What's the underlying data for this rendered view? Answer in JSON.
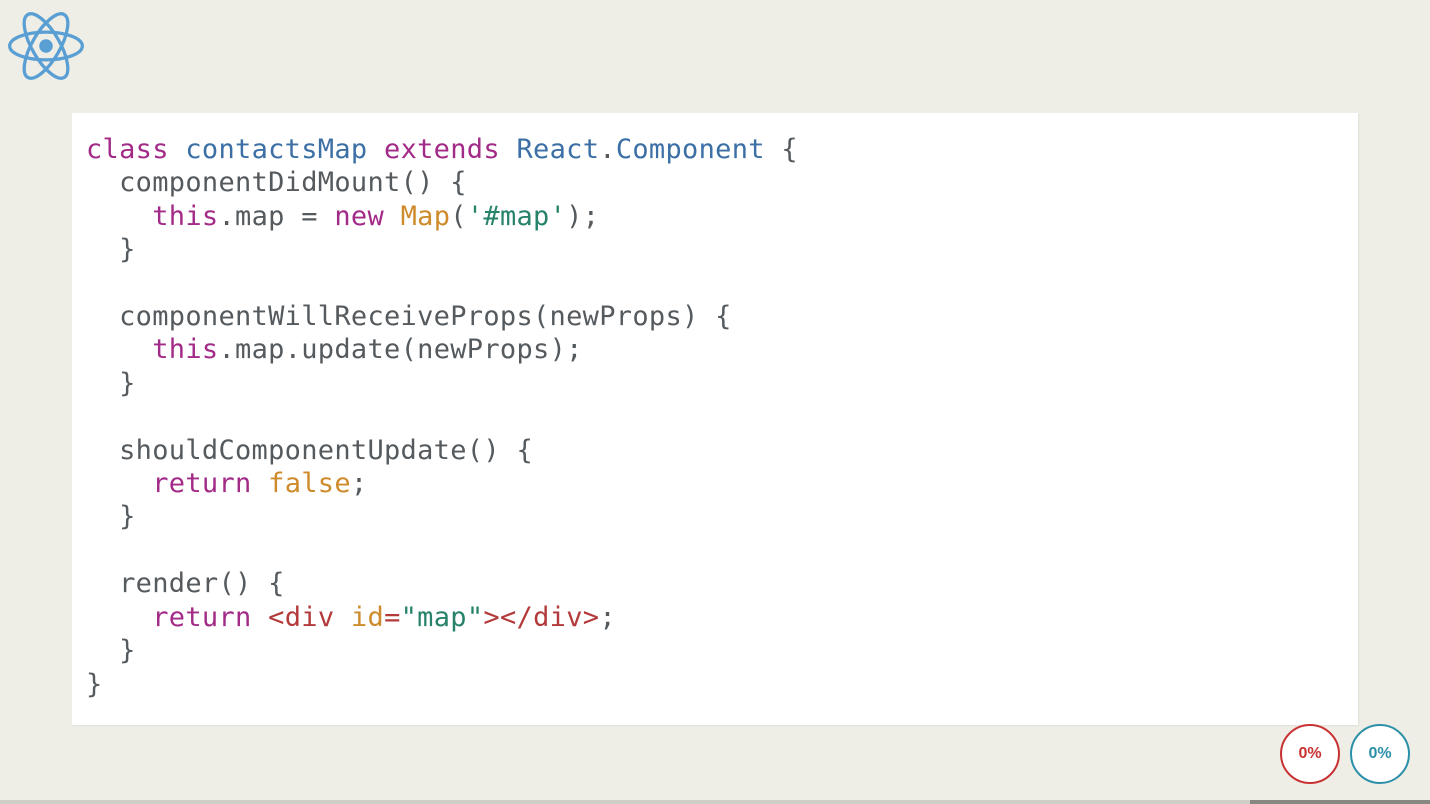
{
  "logo": {
    "name": "react-logo"
  },
  "code": {
    "tokens": [
      [
        {
          "t": "class",
          "c": "tok-keyword"
        },
        {
          "t": " "
        },
        {
          "t": "contactsMap",
          "c": "tok-classname"
        },
        {
          "t": " "
        },
        {
          "t": "extends",
          "c": "tok-keyword"
        },
        {
          "t": " "
        },
        {
          "t": "React",
          "c": "tok-builtin"
        },
        {
          "t": "."
        },
        {
          "t": "Component",
          "c": "tok-builtin"
        },
        {
          "t": " {"
        }
      ],
      [
        {
          "t": "  componentDidMount() {"
        }
      ],
      [
        {
          "t": "    "
        },
        {
          "t": "this",
          "c": "tok-this"
        },
        {
          "t": ".map = "
        },
        {
          "t": "new",
          "c": "tok-new"
        },
        {
          "t": " "
        },
        {
          "t": "Map",
          "c": "tok-func"
        },
        {
          "t": "("
        },
        {
          "t": "'#map'",
          "c": "tok-string"
        },
        {
          "t": ");"
        }
      ],
      [
        {
          "t": "  }"
        }
      ],
      [
        {
          "t": ""
        }
      ],
      [
        {
          "t": "  componentWillReceiveProps(newProps) {"
        }
      ],
      [
        {
          "t": "    "
        },
        {
          "t": "this",
          "c": "tok-this"
        },
        {
          "t": ".map.update(newProps);"
        }
      ],
      [
        {
          "t": "  }"
        }
      ],
      [
        {
          "t": ""
        }
      ],
      [
        {
          "t": "  shouldComponentUpdate() {"
        }
      ],
      [
        {
          "t": "    "
        },
        {
          "t": "return",
          "c": "tok-return"
        },
        {
          "t": " "
        },
        {
          "t": "false",
          "c": "tok-bool"
        },
        {
          "t": ";"
        }
      ],
      [
        {
          "t": "  }"
        }
      ],
      [
        {
          "t": ""
        }
      ],
      [
        {
          "t": "  render() {"
        }
      ],
      [
        {
          "t": "    "
        },
        {
          "t": "return",
          "c": "tok-return"
        },
        {
          "t": " "
        },
        {
          "t": "<",
          "c": "tok-tag"
        },
        {
          "t": "div",
          "c": "tok-tagname"
        },
        {
          "t": " "
        },
        {
          "t": "id",
          "c": "tok-attr"
        },
        {
          "t": "=",
          "c": "tok-tag"
        },
        {
          "t": "\"map\"",
          "c": "tok-attrval"
        },
        {
          "t": ">",
          "c": "tok-tag"
        },
        {
          "t": "</",
          "c": "tok-tag"
        },
        {
          "t": "div",
          "c": "tok-tagname"
        },
        {
          "t": ">",
          "c": "tok-tag"
        },
        {
          "t": ";"
        }
      ],
      [
        {
          "t": "  }"
        }
      ],
      [
        {
          "t": "}"
        }
      ]
    ]
  },
  "circles": {
    "red": "0%",
    "blue": "0%"
  }
}
